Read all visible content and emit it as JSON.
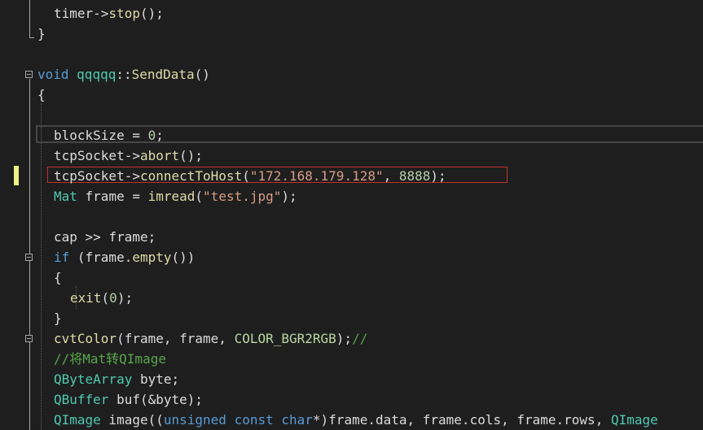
{
  "editor": {
    "lines": [
      {
        "indent": 2,
        "tokens": [
          {
            "t": "timer",
            "c": "vr"
          },
          {
            "t": "->",
            "c": "vr"
          },
          {
            "t": "stop",
            "c": "fn"
          },
          {
            "t": "();",
            "c": "vr"
          }
        ]
      },
      {
        "indent": 0,
        "tokens": [
          {
            "t": "}",
            "c": "vr"
          }
        ]
      },
      {
        "indent": 0,
        "tokens": []
      },
      {
        "indent": 0,
        "tokens": [
          {
            "t": "void",
            "c": "kw"
          },
          {
            "t": " ",
            "c": "vr"
          },
          {
            "t": "qqqqq",
            "c": "ty"
          },
          {
            "t": "::",
            "c": "vr"
          },
          {
            "t": "SendData",
            "c": "fn"
          },
          {
            "t": "()",
            "c": "vr"
          }
        ]
      },
      {
        "indent": 0,
        "tokens": [
          {
            "t": "{",
            "c": "vr"
          }
        ]
      },
      {
        "indent": 0,
        "tokens": []
      },
      {
        "indent": 2,
        "tokens": [
          {
            "t": "blockSize",
            "c": "vr"
          },
          {
            "t": " = ",
            "c": "vr"
          },
          {
            "t": "0",
            "c": "nm"
          },
          {
            "t": ";",
            "c": "vr"
          }
        ]
      },
      {
        "indent": 2,
        "tokens": [
          {
            "t": "tcpSocket",
            "c": "vr"
          },
          {
            "t": "->",
            "c": "vr"
          },
          {
            "t": "abort",
            "c": "fn"
          },
          {
            "t": "();",
            "c": "vr"
          }
        ]
      },
      {
        "indent": 2,
        "tokens": [
          {
            "t": "tcpSocket",
            "c": "vr"
          },
          {
            "t": "->",
            "c": "vr"
          },
          {
            "t": "connectToHost",
            "c": "fn"
          },
          {
            "t": "(",
            "c": "vr"
          },
          {
            "t": "\"172.168.179.128\"",
            "c": "st"
          },
          {
            "t": ", ",
            "c": "vr"
          },
          {
            "t": "8888",
            "c": "nm"
          },
          {
            "t": ");",
            "c": "vr"
          }
        ]
      },
      {
        "indent": 2,
        "tokens": [
          {
            "t": "Mat",
            "c": "ty"
          },
          {
            "t": " frame = ",
            "c": "vr"
          },
          {
            "t": "imread",
            "c": "fn"
          },
          {
            "t": "(",
            "c": "vr"
          },
          {
            "t": "\"test.jpg\"",
            "c": "st"
          },
          {
            "t": ");",
            "c": "vr"
          }
        ]
      },
      {
        "indent": 0,
        "tokens": []
      },
      {
        "indent": 2,
        "tokens": [
          {
            "t": "cap",
            "c": "vr"
          },
          {
            "t": " >> ",
            "c": "vr"
          },
          {
            "t": "frame",
            "c": "vr"
          },
          {
            "t": ";",
            "c": "vr"
          }
        ]
      },
      {
        "indent": 2,
        "tokens": [
          {
            "t": "if",
            "c": "kw"
          },
          {
            "t": " (frame.",
            "c": "vr"
          },
          {
            "t": "empty",
            "c": "fn"
          },
          {
            "t": "())",
            "c": "vr"
          }
        ]
      },
      {
        "indent": 2,
        "tokens": [
          {
            "t": "{",
            "c": "vr"
          }
        ]
      },
      {
        "indent": 4,
        "tokens": [
          {
            "t": "exit",
            "c": "fn"
          },
          {
            "t": "(",
            "c": "vr"
          },
          {
            "t": "0",
            "c": "nm"
          },
          {
            "t": ");",
            "c": "vr"
          }
        ]
      },
      {
        "indent": 2,
        "tokens": [
          {
            "t": "}",
            "c": "vr"
          }
        ]
      },
      {
        "indent": 2,
        "tokens": [
          {
            "t": "cvtColor",
            "c": "fn"
          },
          {
            "t": "(frame, frame, ",
            "c": "vr"
          },
          {
            "t": "COLOR_BGR2RGB",
            "c": "mc"
          },
          {
            "t": ");",
            "c": "vr"
          },
          {
            "t": "//",
            "c": "cm"
          }
        ]
      },
      {
        "indent": 2,
        "tokens": [
          {
            "t": "//将Mat转QImage",
            "c": "cm"
          }
        ]
      },
      {
        "indent": 2,
        "tokens": [
          {
            "t": "QByteArray",
            "c": "ty"
          },
          {
            "t": " byte;",
            "c": "vr"
          }
        ]
      },
      {
        "indent": 2,
        "tokens": [
          {
            "t": "QBuffer",
            "c": "ty"
          },
          {
            "t": " buf(&byte);",
            "c": "vr"
          }
        ]
      },
      {
        "indent": 2,
        "tokens": [
          {
            "t": "QImage",
            "c": "ty"
          },
          {
            "t": " image((",
            "c": "vr"
          },
          {
            "t": "unsigned",
            "c": "kw"
          },
          {
            "t": " ",
            "c": "vr"
          },
          {
            "t": "const",
            "c": "kw"
          },
          {
            "t": " ",
            "c": "vr"
          },
          {
            "t": "char",
            "c": "kw"
          },
          {
            "t": "*)frame.data, frame.cols, frame.rows, ",
            "c": "vr"
          },
          {
            "t": "QImage",
            "c": "ty"
          }
        ]
      }
    ]
  },
  "colors": {
    "background": "#1e1e1e",
    "keyword": "#569cd6",
    "type": "#4ec9b0",
    "function": "#dcdcaa",
    "string": "#d69d85",
    "number": "#b5cea8",
    "macro": "#b8d7a3",
    "comment": "#57a64a",
    "text": "#dcdcdc",
    "highlight_border": "#c53030",
    "change_marker": "#eff284"
  },
  "icons": [
    "fold-collapse-icon"
  ]
}
